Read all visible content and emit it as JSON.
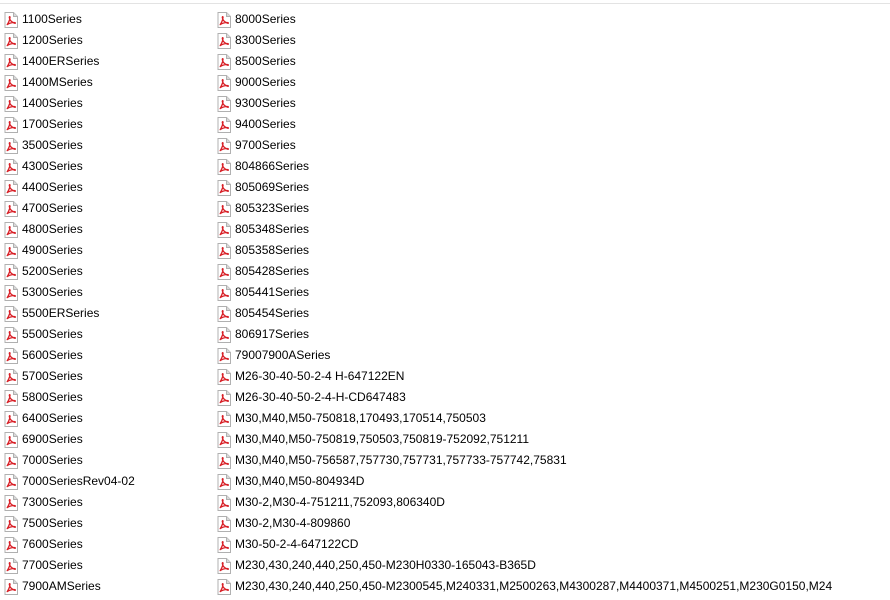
{
  "file_type_icon": "pdf-file-icon",
  "icon_colors": {
    "page": "#ffffff",
    "border": "#b0b0b0",
    "fold": "#d9d9d9",
    "accent": "#d81f26"
  },
  "left_files": [
    "1100Series",
    "1200Series",
    "1400ERSeries",
    "1400MSeries",
    "1400Series",
    "1700Series",
    "3500Series",
    "4300Series",
    "4400Series",
    "4700Series",
    "4800Series",
    "4900Series",
    "5200Series",
    "5300Series",
    "5500ERSeries",
    "5500Series",
    "5600Series",
    "5700Series",
    "5800Series",
    "6400Series",
    "6900Series",
    "7000Series",
    "7000SeriesRev04-02",
    "7300Series",
    "7500Series",
    "7600Series",
    "7700Series",
    "7900AMSeries"
  ],
  "right_files": [
    "8000Series",
    "8300Series",
    "8500Series",
    "9000Series",
    "9300Series",
    "9400Series",
    "9700Series",
    "804866Series",
    "805069Series",
    "805323Series",
    "805348Series",
    "805358Series",
    "805428Series",
    "805441Series",
    "805454Series",
    "806917Series",
    "79007900ASeries",
    "M26-30-40-50-2-4 H-647122EN",
    "M26-30-40-50-2-4-H-CD647483",
    "M30,M40,M50-750818,170493,170514,750503",
    "M30,M40,M50-750819,750503,750819-752092,751211",
    "M30,M40,M50-756587,757730,757731,757733-757742,75831",
    "M30,M40,M50-804934D",
    "M30-2,M30-4-751211,752093,806340D",
    "M30-2,M30-4-809860",
    "M30-50-2-4-647122CD",
    "M230,430,240,440,250,450-M230H0330-165043-B365D",
    "M230,430,240,440,250,450-M2300545,M240331,M2500263,M4300287,M4400371,M4500251,M230G0150,M24"
  ]
}
